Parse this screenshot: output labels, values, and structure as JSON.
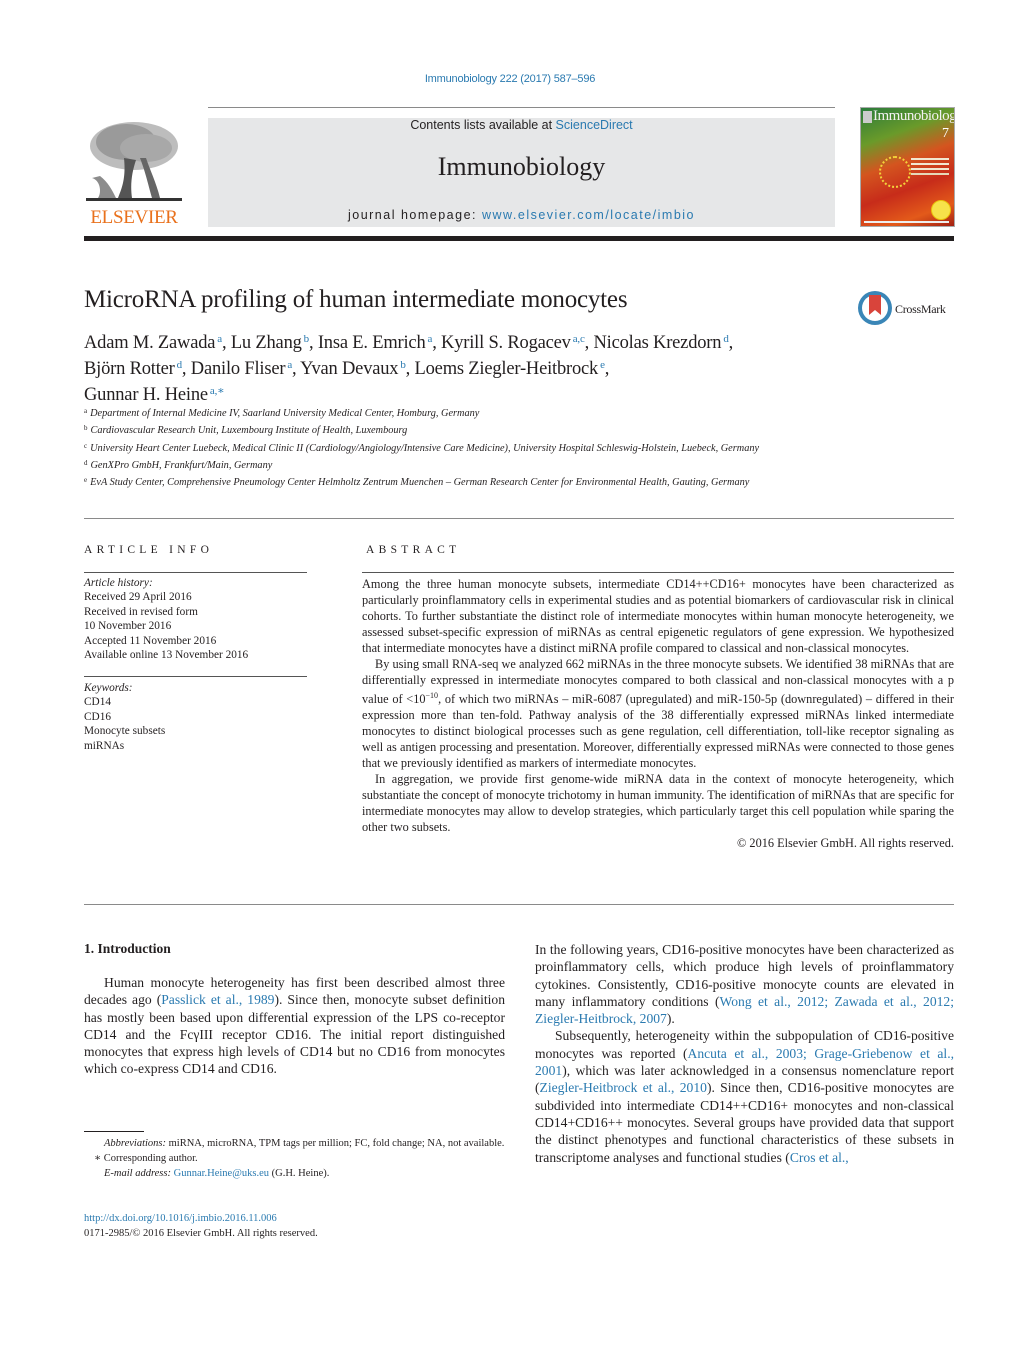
{
  "header": {
    "citation": "Immunobiology 222 (2017) 587–596",
    "contents_prefix": "Contents lists available at ",
    "contents_link": "ScienceDirect",
    "journal_name": "Immunobiology",
    "homepage_prefix": "journal homepage: ",
    "homepage_link": "www.elsevier.com/locate/imbio",
    "publisher_logo_text": "ELSEVIER",
    "cover_title": "Immunobiology",
    "cover_issue": "7",
    "crossmark_label": "CrossMark"
  },
  "article": {
    "title": "MicroRNA profiling of human intermediate monocytes",
    "authors": [
      {
        "name": "Adam M. Zawada",
        "aff": "a",
        "sep": ", "
      },
      {
        "name": "Lu Zhang",
        "aff": "b",
        "sep": ", "
      },
      {
        "name": "Insa E. Emrich",
        "aff": "a",
        "sep": ", "
      },
      {
        "name": "Kyrill S. Rogacev",
        "aff": "a,c",
        "sep": ", "
      },
      {
        "name": "Nicolas Krezdorn",
        "aff": "d",
        "sep": ","
      },
      {
        "name": "Björn Rotter",
        "aff": "d",
        "sep": ", "
      },
      {
        "name": "Danilo Fliser",
        "aff": "a",
        "sep": ", "
      },
      {
        "name": "Yvan Devaux",
        "aff": "b",
        "sep": ", "
      },
      {
        "name": "Loems Ziegler-Heitbrock",
        "aff": "e",
        "sep": ","
      },
      {
        "name": "Gunnar H. Heine",
        "aff": "a,∗",
        "sep": ""
      }
    ],
    "affiliations": [
      {
        "mark": "a",
        "text": "Department of Internal Medicine IV, Saarland University Medical Center, Homburg, Germany"
      },
      {
        "mark": "b",
        "text": "Cardiovascular Research Unit, Luxembourg Institute of Health, Luxembourg"
      },
      {
        "mark": "c",
        "text": "University Heart Center Luebeck, Medical Clinic II (Cardiology/Angiology/Intensive Care Medicine), University Hospital Schleswig-Holstein, Luebeck, Germany"
      },
      {
        "mark": "d",
        "text": "GenXPro GmbH, Frankfurt/Main, Germany"
      },
      {
        "mark": "e",
        "text": "EvA Study Center, Comprehensive Pneumology Center Helmholtz Zentrum Muenchen – German Research Center for Environmental Health, Gauting, Germany"
      }
    ]
  },
  "article_info": {
    "label": "ARTICLE INFO",
    "history_label": "Article history:",
    "history": [
      "Received 29 April 2016",
      "Received in revised form",
      "10 November 2016",
      "Accepted 11 November 2016",
      "Available online 13 November 2016"
    ],
    "keywords_label": "Keywords:",
    "keywords": [
      "CD14",
      "CD16",
      "Monocyte subsets",
      "miRNAs"
    ]
  },
  "abstract": {
    "label": "ABSTRACT",
    "p1": "Among the three human monocyte subsets, intermediate CD14++CD16+ monocytes have been characterized as particularly proinflammatory cells in experimental studies and as potential biomarkers of cardiovascular risk in clinical cohorts. To further substantiate the distinct role of intermediate monocytes within human monocyte heterogeneity, we assessed subset-specific expression of miRNAs as central epigenetic regulators of gene expression. We hypothesized that intermediate monocytes have a distinct miRNA profile compared to classical and non-classical monocytes.",
    "p2_a": "By using small RNA-seq we analyzed 662 miRNAs in the three monocyte subsets. We identified 38 miRNAs that are differentially expressed in intermediate monocytes compared to both classical and non-classical monocytes with a p value of <10",
    "p2_exp": "−10",
    "p2_b": ", of which two miRNAs – miR-6087 (upregulated) and miR-150-5p (downregulated) – differed in their expression more than ten-fold. Pathway analysis of the 38 differentially expressed miRNAs linked intermediate monocytes to distinct biological processes such as gene regulation, cell differentiation, toll-like receptor signaling as well as antigen processing and presentation. Moreover, differentially expressed miRNAs were connected to those genes that we previously identified as markers of intermediate monocytes.",
    "p3": "In aggregation, we provide first genome-wide miRNA data in the context of monocyte heterogeneity, which substantiate the concept of monocyte trichotomy in human immunity. The identification of miRNAs that are specific for intermediate monocytes may allow to develop strategies, which particularly target this cell population while sparing the other two subsets.",
    "copyright": "© 2016 Elsevier GmbH. All rights reserved."
  },
  "introduction": {
    "heading": "1.  Introduction",
    "left_p1_a": "Human monocyte heterogeneity has first been described almost three decades ago (",
    "left_p1_ref1": "Passlick et al., 1989",
    "left_p1_b": "). Since then, monocyte subset definition has mostly been based upon differential expression of the LPS co-receptor CD14 and the FcγIII receptor CD16. The initial report distinguished monocytes that express high levels of CD14 but no CD16 from monocytes which co-express CD14 and CD16.",
    "right_p1_a": "In the following years, CD16-positive monocytes have been characterized as proinflammatory cells, which produce high levels of proinflammatory cytokines. Consistently, CD16-positive monocyte counts are elevated in many inflammatory conditions (",
    "right_p1_ref": "Wong et al., 2012; Zawada et al., 2012; Ziegler-Heitbrock, 2007",
    "right_p1_b": ").",
    "right_p2_a": "Subsequently, heterogeneity within the subpopulation of CD16-positive monocytes was reported (",
    "right_p2_ref1": "Ancuta et al., 2003; Grage-Griebenow et al., 2001",
    "right_p2_b": "), which was later acknowledged in a consensus nomenclature report (",
    "right_p2_ref2": "Ziegler-Heitbrock et al., 2010",
    "right_p2_c": "). Since then, CD16-positive monocytes are subdivided into intermediate CD14++CD16+ monocytes and non-classical CD14+CD16++ monocytes. Several groups have provided data that support the distinct phenotypes and functional characteristics of these subsets in transcriptome analyses and functional studies (",
    "right_p2_ref3": "Cros et al.,"
  },
  "footnotes": {
    "abbrev_label": "Abbreviations:",
    "abbrev_text": " miRNA, microRNA, TPM tags per million; FC, fold change; NA, not available.",
    "corr_mark": "∗",
    "corr_text": " Corresponding author.",
    "email_label": "E-mail address:",
    "email": "Gunnar.Heine@uks.eu",
    "email_suffix": " (G.H. Heine).",
    "doi": "http://dx.doi.org/10.1016/j.imbio.2016.11.006",
    "issn_line": "0171-2985/© 2016 Elsevier GmbH. All rights reserved."
  }
}
